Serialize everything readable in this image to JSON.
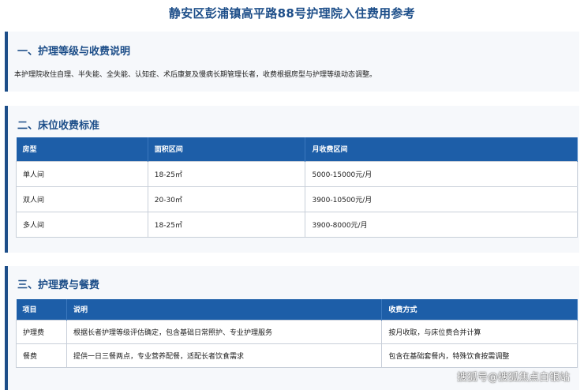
{
  "title": "静安区彭浦镇高平路88号护理院入住费用参考",
  "section1": {
    "heading": "一、护理等级与收费说明",
    "text": "本护理院收住自理、半失能、全失能、认知症、术后康复及慢病长期管理长者，收费根据房型与护理等级动态调整。"
  },
  "section2": {
    "heading": "二、床位收费标准",
    "headers": [
      "房型",
      "面积区间",
      "月收费区间"
    ],
    "rows": [
      [
        "单人间",
        "18-25㎡",
        "5000-15000元/月"
      ],
      [
        "双人间",
        "20-30㎡",
        "3900-10500元/月"
      ],
      [
        "多人间",
        "18-25㎡",
        "3900-8000元/月"
      ]
    ]
  },
  "section3": {
    "heading": "三、护理费与餐费",
    "headers": [
      "项目",
      "说明",
      "收费方式"
    ],
    "rows": [
      [
        "护理费",
        "根据长者护理等级评估确定，包含基础日常照护、专业护理服务",
        "按月收取，与床位费合并计算"
      ],
      [
        "餐费",
        "提供一日三餐两点，专业营养配餐，适配长者饮食需求",
        "包含在基础套餐内，特殊饮食按需调整"
      ]
    ]
  },
  "watermark": "搜狐号@搜狐焦点白银站"
}
